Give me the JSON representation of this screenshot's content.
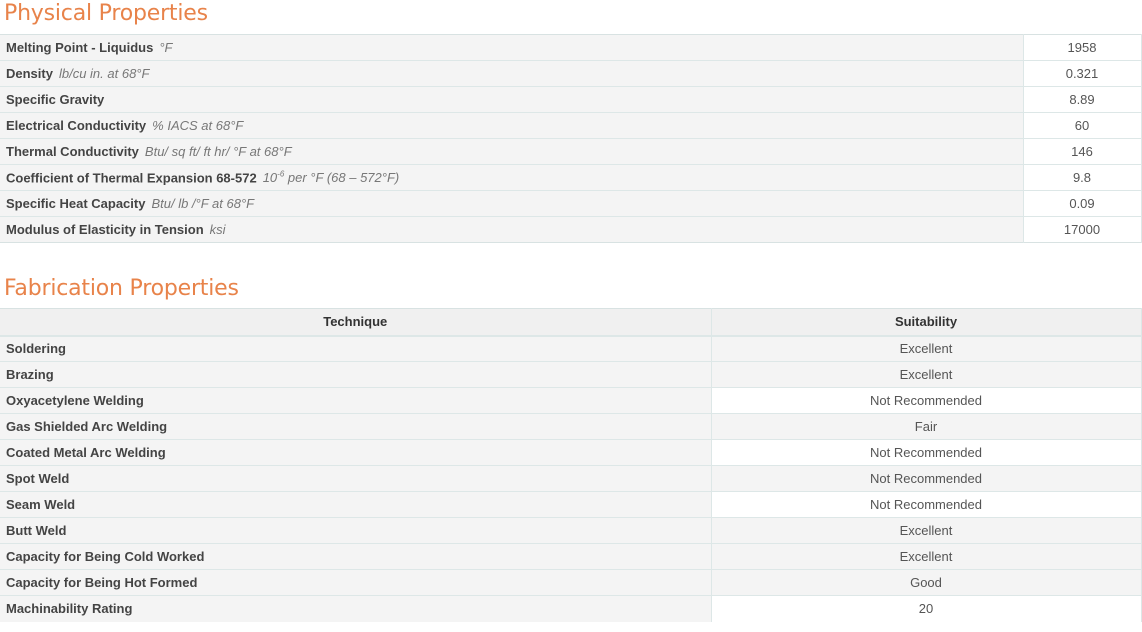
{
  "physical": {
    "title": "Physical Properties",
    "rows": [
      {
        "label": "Melting Point - Liquidus",
        "unit": "°F",
        "value": "1958"
      },
      {
        "label": "Density",
        "unit": "lb/cu in. at 68°F",
        "value": "0.321"
      },
      {
        "label": "Specific Gravity",
        "unit": "",
        "value": "8.89"
      },
      {
        "label": "Electrical Conductivity",
        "unit": "% IACS at 68°F",
        "value": "60"
      },
      {
        "label": "Thermal Conductivity",
        "unit": "Btu/ sq ft/ ft hr/ °F at 68°F",
        "value": "146"
      },
      {
        "label": "Coefficient of Thermal Expansion 68-572",
        "unit_pre": "10",
        "unit_sup": "-6",
        "unit_post": "per °F (68 – 572°F)",
        "value": "9.8"
      },
      {
        "label": "Specific Heat Capacity",
        "unit": "Btu/ lb /°F at 68°F",
        "value": "0.09"
      },
      {
        "label": "Modulus of Elasticity in Tension",
        "unit": "ksi",
        "value": "17000"
      }
    ]
  },
  "fabrication": {
    "title": "Fabrication Properties",
    "headers": {
      "technique": "Technique",
      "suitability": "Suitability"
    },
    "rows": [
      {
        "technique": "Soldering",
        "suitability": "Excellent"
      },
      {
        "technique": "Brazing",
        "suitability": "Excellent"
      },
      {
        "technique": "Oxyacetylene Welding",
        "suitability": "Not Recommended"
      },
      {
        "technique": "Gas Shielded Arc Welding",
        "suitability": "Fair"
      },
      {
        "technique": "Coated Metal Arc Welding",
        "suitability": "Not Recommended"
      },
      {
        "technique": "Spot Weld",
        "suitability": "Not Recommended"
      },
      {
        "technique": "Seam Weld",
        "suitability": "Not Recommended"
      },
      {
        "technique": "Butt Weld",
        "suitability": "Excellent"
      },
      {
        "technique": "Capacity for Being Cold Worked",
        "suitability": "Excellent"
      },
      {
        "technique": "Capacity for Being Hot Formed",
        "suitability": "Good"
      },
      {
        "technique": "Machinability Rating",
        "suitability": "20"
      }
    ]
  }
}
